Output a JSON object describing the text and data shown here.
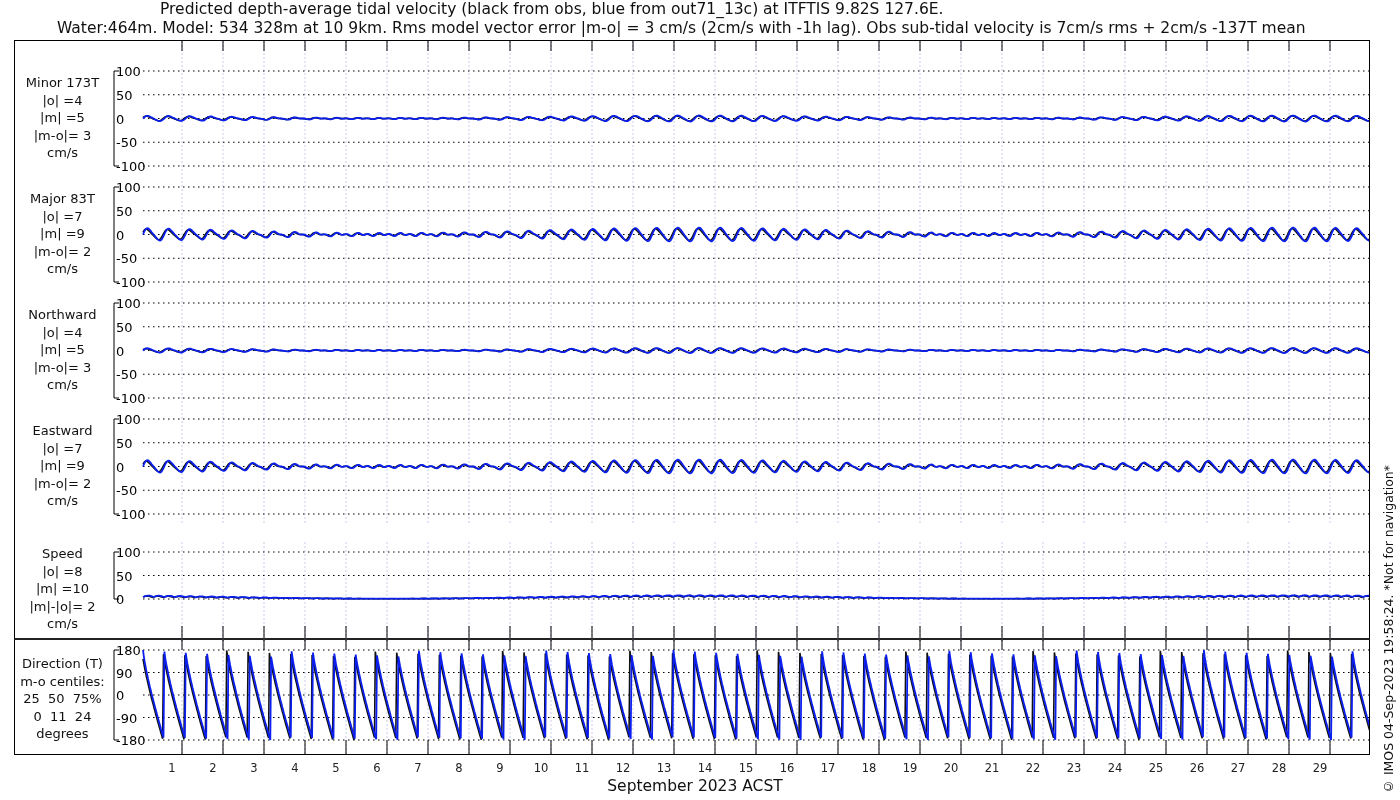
{
  "title": {
    "line_1": "Predicted depth-average tidal velocity (black from obs, blue from out71_13c) at ITFTIS 9.82S 127.6E.",
    "line_2": "Water:464m. Model: 534 328m at 10 9km. Rms model vector error |m-o| = 3 cm/s (2cm/s with -1h lag). Obs sub-tidal velocity is 7cm/s rms + 2cm/s -137T mean"
  },
  "panels": [
    {
      "kind": "velocity",
      "label": [
        "Minor 173T",
        "|o| =4",
        "|m| =5",
        "|m-o|= 3",
        "cm/s"
      ],
      "yticks": [
        "100",
        "50",
        "0",
        "-50",
        "-100"
      ]
    },
    {
      "kind": "velocity",
      "label": [
        "Major 83T",
        "|o| =7",
        "|m| =9",
        "|m-o|= 2",
        "cm/s"
      ],
      "yticks": [
        "100",
        "50",
        "0",
        "-50",
        "-100"
      ]
    },
    {
      "kind": "velocity",
      "label": [
        "Northward",
        "|o| =4",
        "|m| =5",
        "|m-o|= 3",
        "cm/s"
      ],
      "yticks": [
        "100",
        "50",
        "0",
        "-50",
        "-100"
      ]
    },
    {
      "kind": "velocity",
      "label": [
        "Eastward",
        "|o| =7",
        "|m| =9",
        "|m-o|= 2",
        "cm/s"
      ],
      "yticks": [
        "100",
        "50",
        "0",
        "-50",
        "-100"
      ]
    },
    {
      "kind": "speed",
      "label": [
        "Speed",
        "|o| =8",
        "|m| =10",
        "|m|-|o|= 2",
        "cm/s"
      ],
      "yticks": [
        "100",
        "50",
        "0"
      ]
    }
  ],
  "direction_panel": {
    "kind": "direction",
    "label": [
      "Direction (T)",
      "m-o centiles:",
      "25  50  75%",
      "0  11  24",
      "degrees"
    ],
    "yticks": [
      "180",
      "90",
      "0",
      "-90",
      "-180"
    ]
  },
  "x_axis": {
    "labels": [
      "1",
      "2",
      "3",
      "4",
      "5",
      "6",
      "7",
      "8",
      "9",
      "10",
      "11",
      "12",
      "13",
      "14",
      "15",
      "16",
      "17",
      "18",
      "19",
      "20",
      "21",
      "22",
      "23",
      "24",
      "25",
      "26",
      "27",
      "28",
      "29"
    ],
    "title": "September 2023 ACST"
  },
  "side_note": "© IMOS 04-Sep-2023 19:58:24. *Not for navigation*"
}
